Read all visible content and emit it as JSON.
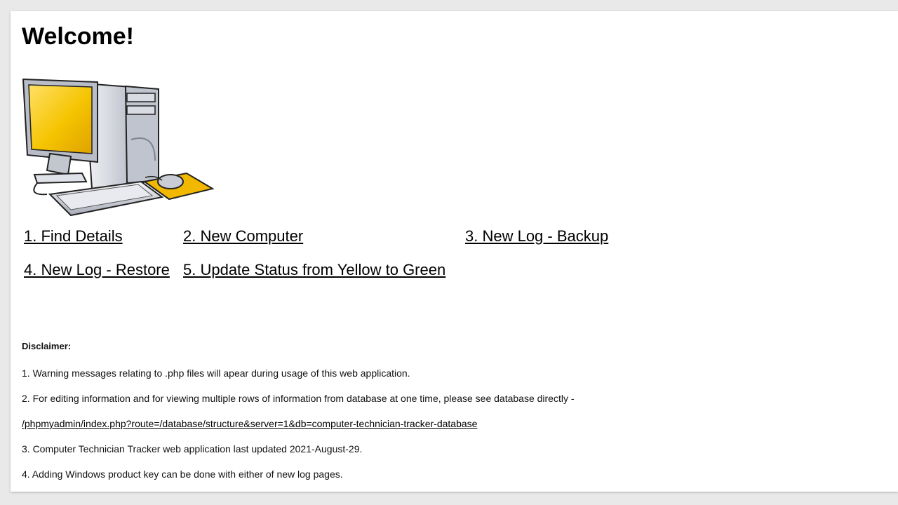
{
  "page": {
    "title": "Welcome!"
  },
  "hero": {
    "icon": "desktop-computer-icon",
    "colors": {
      "screen": "#f5c400",
      "tower": "#c9cdd6",
      "mousepad": "#f2b800"
    }
  },
  "nav": {
    "items": [
      {
        "label": "1. Find Details"
      },
      {
        "label": "2. New Computer"
      },
      {
        "label": "3. New Log - Backup"
      },
      {
        "label": "4. New Log - Restore"
      },
      {
        "label": "5. Update Status from Yellow to Green"
      }
    ]
  },
  "disclaimer": {
    "heading": "Disclaimer:",
    "line1": "1. Warning messages relating to .php files will apear during usage of this web application.",
    "line2": "2. For editing information and for viewing multiple rows of information from database at one time, please see database directly -",
    "link": "/phpmyadmin/index.php?route=/database/structure&server=1&db=computer-technician-tracker-database",
    "line3": "3. Computer Technician Tracker web application last updated 2021-August-29.",
    "line4": "4. Adding Windows product key can be done with either of new log pages."
  }
}
